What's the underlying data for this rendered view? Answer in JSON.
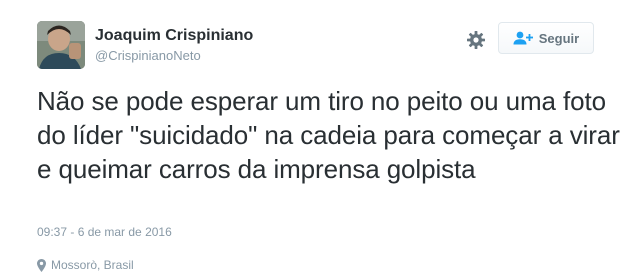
{
  "user": {
    "display_name": "Joaquim Crispiniano",
    "handle": "@CrispinianoNeto"
  },
  "actions": {
    "settings_icon": "gear-icon",
    "follow_icon": "add-user-icon",
    "follow_label": "Seguir"
  },
  "tweet": {
    "text": "Não se pode esperar um tiro no peito ou uma foto do líder \"suicidado\" na cadeia para começar a virar e queimar carros da imprensa golpista",
    "timestamp": "09:37 - 6 de mar de 2016",
    "location_icon": "map-pin-icon",
    "location": "Mossorò, Brasil"
  },
  "colors": {
    "text": "#292f33",
    "secondary_text": "#8899a6",
    "accent": "#1da1f2",
    "button_border": "#e1e8ed"
  }
}
